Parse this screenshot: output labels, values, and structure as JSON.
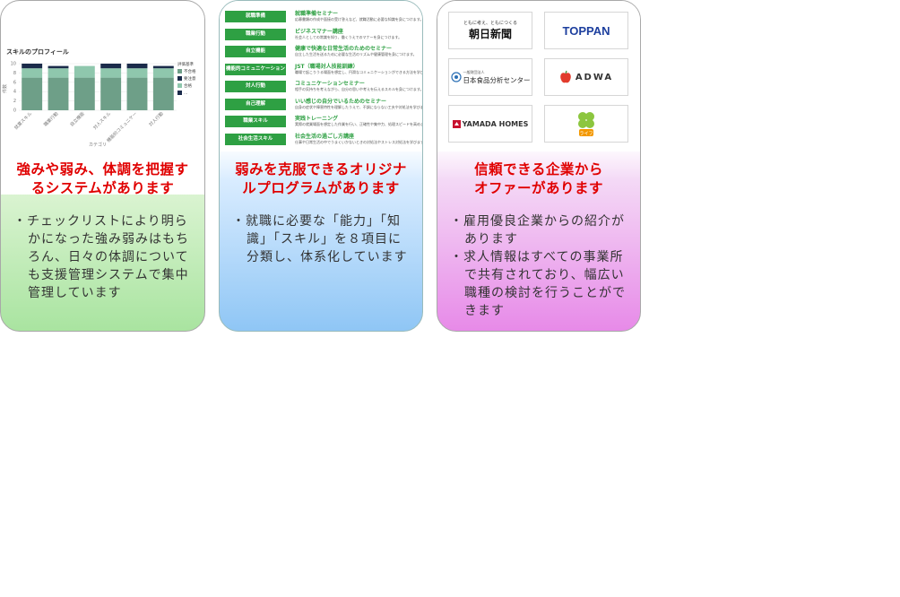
{
  "cards": [
    {
      "headline_line1": "強みや弱み、体調を把握す",
      "headline_line2": "るシステムがあります",
      "bullets": [
        "・チェックリストにより明らかになった強み弱みはもちろん、日々の体調についても支援管理システムで集中管理しています"
      ],
      "image": {
        "chart_title": "スキルのプロフィール",
        "xlabel": "カテゴリ",
        "ylabel": "件数",
        "y_ticks": [
          "10",
          "8",
          "6",
          "4",
          "2",
          "0"
        ],
        "legend_title": "評価基準",
        "legend": [
          "不合格",
          "要注意",
          "合格",
          "…"
        ],
        "chart_data": {
          "type": "bar",
          "stacked": true,
          "categories": [
            "就業スキル",
            "職業行動",
            "自立機能",
            "対人スキル",
            "機能的コミュニケー",
            "対人行動"
          ],
          "series": [
            {
              "name": "合格",
              "values": [
                7,
                7,
                7,
                7,
                7,
                7
              ]
            },
            {
              "name": "要注意",
              "values": [
                2,
                2,
                2.5,
                2,
                2,
                2
              ]
            },
            {
              "name": "不合格",
              "values": [
                1,
                0.5,
                0,
                1,
                1,
                0.5
              ]
            }
          ],
          "ylim": [
            0,
            10
          ],
          "colors": [
            "#6e9f88",
            "#8fc7ad",
            "#1b2b4a"
          ]
        }
      }
    },
    {
      "headline_line1": "弱みを克服できるオリジナ",
      "headline_line2": "ルプログラムがあります",
      "bullets": [
        "・就職に必要な「能力」「知識」「スキル」を８項目に分類し、体系化しています"
      ],
      "programs": [
        {
          "tag": "就職準備",
          "title": "就職準備セミナー",
          "desc": "応募書類の作成や面接の受け答えなど、就職活動に必要な知識を身につけます。"
        },
        {
          "tag": "職業行動",
          "title": "ビジネスマナー講座",
          "desc": "社会人としての常識を知り、働くうえでのマナーを身につけます。"
        },
        {
          "tag": "自立機能",
          "title": "健康で快適な日常生活のためのセミナー",
          "desc": "自立した生活を送るために必要な生活のリズムや健康管理を身につけます。"
        },
        {
          "tag": "機能的コミュニケーション",
          "title": "JST（職場対人技能訓練）",
          "desc": "職場で起こりうる場面を想定し、円滑なコミュニケーションができる方法を学びます。"
        },
        {
          "tag": "対人行動",
          "title": "コミュニケーションセミナー",
          "desc": "相手の気持ちを考えながら、自分の思いや考えを伝えるスキルを身につけます。"
        },
        {
          "tag": "自己理解",
          "title": "いい感じの自分でいるためのセミナー",
          "desc": "自身の症状や障害特性を理解したうえで、不調にならない工夫や対処法を学びます。"
        },
        {
          "tag": "職業スキル",
          "title": "実践トレーニング",
          "desc": "実際の就業場面を想定した作業を行い、正確性や集中力、処理スピードを高めます。"
        },
        {
          "tag": "社会生活スキル",
          "title": "社会生活の過ごし方講座",
          "desc": "仕事や日常生活の中でうまくいかないときの対処法やストレス対処法を学びます。"
        }
      ]
    },
    {
      "headline_line1": "信頼できる企業から",
      "headline_line2": "オファーがあります",
      "bullets": [
        "・雇用優良企業からの紹介があります",
        "・求人情報はすべての事業所で共有されており、幅広い職種の検討を行うことができます"
      ],
      "logos": {
        "asahi_tagline": "ともに考え、ともにつくる",
        "asahi": "朝日新聞",
        "toppan": "TOPPAN",
        "jfrl_small": "一般財団法人",
        "jfrl": "日本食品分析センター",
        "adwa": "ADWA",
        "yamada": "YAMADA HOMES",
        "life": "ライフ"
      }
    }
  ]
}
